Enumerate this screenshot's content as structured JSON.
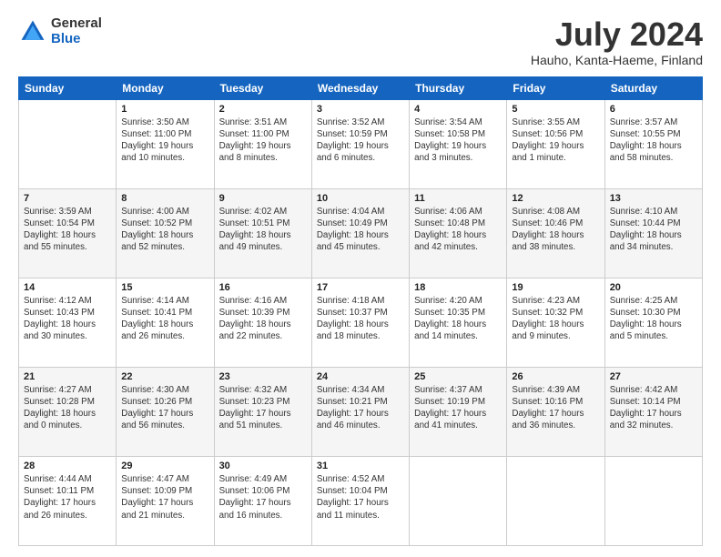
{
  "logo": {
    "general": "General",
    "blue": "Blue"
  },
  "title": "July 2024",
  "subtitle": "Hauho, Kanta-Haeme, Finland",
  "headers": [
    "Sunday",
    "Monday",
    "Tuesday",
    "Wednesday",
    "Thursday",
    "Friday",
    "Saturday"
  ],
  "weeks": [
    [
      {
        "day": "",
        "info": ""
      },
      {
        "day": "1",
        "info": "Sunrise: 3:50 AM\nSunset: 11:00 PM\nDaylight: 19 hours\nand 10 minutes."
      },
      {
        "day": "2",
        "info": "Sunrise: 3:51 AM\nSunset: 11:00 PM\nDaylight: 19 hours\nand 8 minutes."
      },
      {
        "day": "3",
        "info": "Sunrise: 3:52 AM\nSunset: 10:59 PM\nDaylight: 19 hours\nand 6 minutes."
      },
      {
        "day": "4",
        "info": "Sunrise: 3:54 AM\nSunset: 10:58 PM\nDaylight: 19 hours\nand 3 minutes."
      },
      {
        "day": "5",
        "info": "Sunrise: 3:55 AM\nSunset: 10:56 PM\nDaylight: 19 hours\nand 1 minute."
      },
      {
        "day": "6",
        "info": "Sunrise: 3:57 AM\nSunset: 10:55 PM\nDaylight: 18 hours\nand 58 minutes."
      }
    ],
    [
      {
        "day": "7",
        "info": "Sunrise: 3:59 AM\nSunset: 10:54 PM\nDaylight: 18 hours\nand 55 minutes."
      },
      {
        "day": "8",
        "info": "Sunrise: 4:00 AM\nSunset: 10:52 PM\nDaylight: 18 hours\nand 52 minutes."
      },
      {
        "day": "9",
        "info": "Sunrise: 4:02 AM\nSunset: 10:51 PM\nDaylight: 18 hours\nand 49 minutes."
      },
      {
        "day": "10",
        "info": "Sunrise: 4:04 AM\nSunset: 10:49 PM\nDaylight: 18 hours\nand 45 minutes."
      },
      {
        "day": "11",
        "info": "Sunrise: 4:06 AM\nSunset: 10:48 PM\nDaylight: 18 hours\nand 42 minutes."
      },
      {
        "day": "12",
        "info": "Sunrise: 4:08 AM\nSunset: 10:46 PM\nDaylight: 18 hours\nand 38 minutes."
      },
      {
        "day": "13",
        "info": "Sunrise: 4:10 AM\nSunset: 10:44 PM\nDaylight: 18 hours\nand 34 minutes."
      }
    ],
    [
      {
        "day": "14",
        "info": "Sunrise: 4:12 AM\nSunset: 10:43 PM\nDaylight: 18 hours\nand 30 minutes."
      },
      {
        "day": "15",
        "info": "Sunrise: 4:14 AM\nSunset: 10:41 PM\nDaylight: 18 hours\nand 26 minutes."
      },
      {
        "day": "16",
        "info": "Sunrise: 4:16 AM\nSunset: 10:39 PM\nDaylight: 18 hours\nand 22 minutes."
      },
      {
        "day": "17",
        "info": "Sunrise: 4:18 AM\nSunset: 10:37 PM\nDaylight: 18 hours\nand 18 minutes."
      },
      {
        "day": "18",
        "info": "Sunrise: 4:20 AM\nSunset: 10:35 PM\nDaylight: 18 hours\nand 14 minutes."
      },
      {
        "day": "19",
        "info": "Sunrise: 4:23 AM\nSunset: 10:32 PM\nDaylight: 18 hours\nand 9 minutes."
      },
      {
        "day": "20",
        "info": "Sunrise: 4:25 AM\nSunset: 10:30 PM\nDaylight: 18 hours\nand 5 minutes."
      }
    ],
    [
      {
        "day": "21",
        "info": "Sunrise: 4:27 AM\nSunset: 10:28 PM\nDaylight: 18 hours\nand 0 minutes."
      },
      {
        "day": "22",
        "info": "Sunrise: 4:30 AM\nSunset: 10:26 PM\nDaylight: 17 hours\nand 56 minutes."
      },
      {
        "day": "23",
        "info": "Sunrise: 4:32 AM\nSunset: 10:23 PM\nDaylight: 17 hours\nand 51 minutes."
      },
      {
        "day": "24",
        "info": "Sunrise: 4:34 AM\nSunset: 10:21 PM\nDaylight: 17 hours\nand 46 minutes."
      },
      {
        "day": "25",
        "info": "Sunrise: 4:37 AM\nSunset: 10:19 PM\nDaylight: 17 hours\nand 41 minutes."
      },
      {
        "day": "26",
        "info": "Sunrise: 4:39 AM\nSunset: 10:16 PM\nDaylight: 17 hours\nand 36 minutes."
      },
      {
        "day": "27",
        "info": "Sunrise: 4:42 AM\nSunset: 10:14 PM\nDaylight: 17 hours\nand 32 minutes."
      }
    ],
    [
      {
        "day": "28",
        "info": "Sunrise: 4:44 AM\nSunset: 10:11 PM\nDaylight: 17 hours\nand 26 minutes."
      },
      {
        "day": "29",
        "info": "Sunrise: 4:47 AM\nSunset: 10:09 PM\nDaylight: 17 hours\nand 21 minutes."
      },
      {
        "day": "30",
        "info": "Sunrise: 4:49 AM\nSunset: 10:06 PM\nDaylight: 17 hours\nand 16 minutes."
      },
      {
        "day": "31",
        "info": "Sunrise: 4:52 AM\nSunset: 10:04 PM\nDaylight: 17 hours\nand 11 minutes."
      },
      {
        "day": "",
        "info": ""
      },
      {
        "day": "",
        "info": ""
      },
      {
        "day": "",
        "info": ""
      }
    ]
  ]
}
